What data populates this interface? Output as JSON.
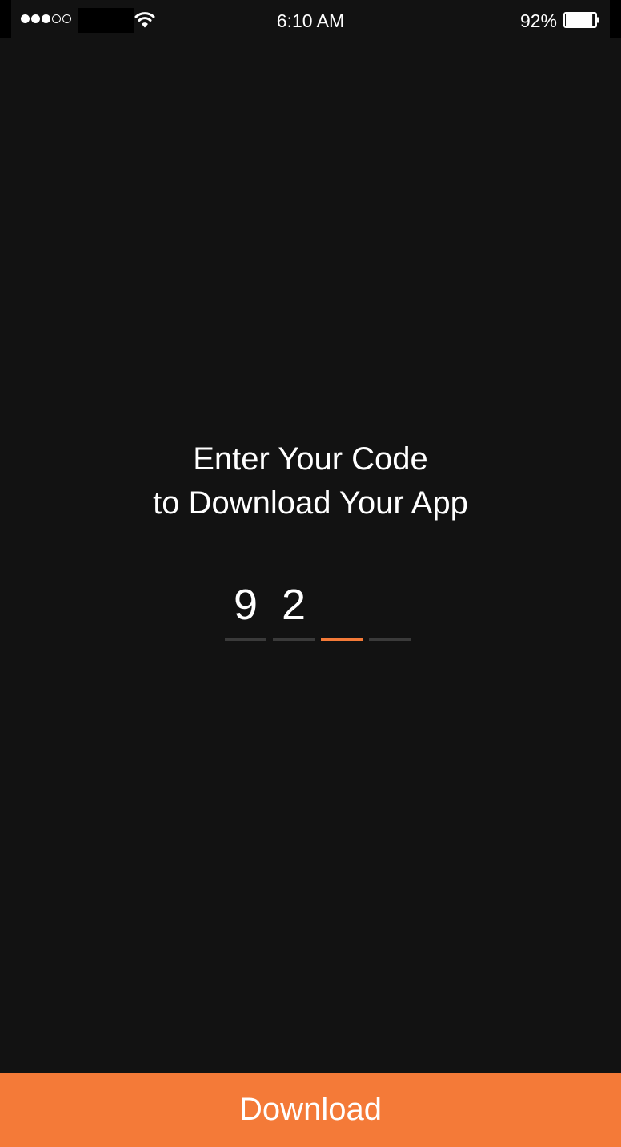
{
  "status_bar": {
    "signal_strength": 3,
    "signal_max": 5,
    "time": "6:10 AM",
    "battery_percent_label": "92%",
    "battery_level": 0.92,
    "icons": [
      "signal-dots-icon",
      "wifi-icon",
      "battery-icon"
    ]
  },
  "headline": {
    "line1": "Enter Your Code",
    "line2": "to Download Your App"
  },
  "code": {
    "digits": [
      "9",
      "2",
      "",
      ""
    ],
    "active_index": 2
  },
  "download_button": {
    "label": "Download"
  },
  "colors": {
    "accent": "#f47a38",
    "background": "#121212",
    "inactive_underline": "#3a3a3a",
    "text": "#ffffff"
  }
}
